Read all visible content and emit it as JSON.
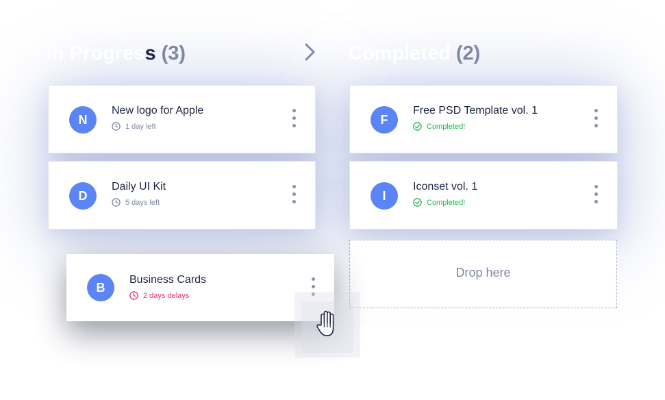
{
  "columns": {
    "in_progress": {
      "title_faded": "In Progres",
      "title_dark": "s",
      "count": "(3)"
    },
    "completed": {
      "title": "Completed",
      "count": "(2)"
    }
  },
  "in_progress_cards": [
    {
      "initial": "N",
      "title": "New logo for Apple",
      "status": "1 day left",
      "status_icon": "clock-icon"
    },
    {
      "initial": "D",
      "title": "Daily UI Kit",
      "status": "5 days left",
      "status_icon": "clock-icon"
    }
  ],
  "dragged_card": {
    "initial": "B",
    "title": "Business Cards",
    "status": "2 days delays",
    "status_icon": "clock-icon"
  },
  "completed_cards": [
    {
      "initial": "F",
      "title": "Free PSD Template vol. 1",
      "status": "Completed!",
      "status_icon": "check-circle-icon"
    },
    {
      "initial": "I",
      "title": "Iconset vol. 1",
      "status": "Completed!",
      "status_icon": "check-circle-icon"
    }
  ],
  "drop_zone": {
    "label": "Drop here"
  },
  "colors": {
    "avatar": "#5b85f5",
    "title": "#1b2340",
    "muted": "#7e87a6",
    "completed": "#24b34a",
    "delayed": "#e8336b"
  },
  "icons": {
    "next": "chevron-right-icon",
    "cursor": "grab-hand-icon",
    "menu": "kebab-menu-icon"
  }
}
